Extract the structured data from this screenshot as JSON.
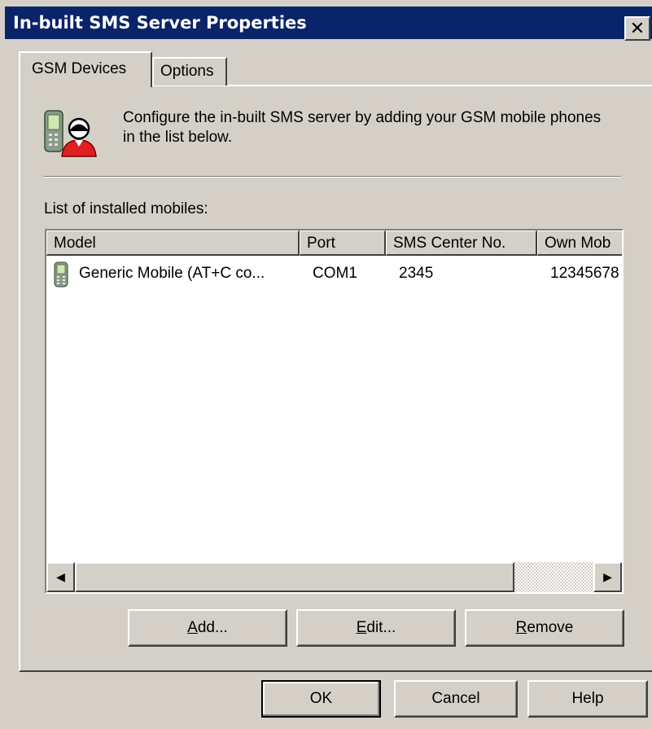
{
  "window": {
    "title": "In-built SMS Server Properties",
    "close_glyph": "✕"
  },
  "tabs": [
    {
      "label": "GSM Devices",
      "selected": true
    },
    {
      "label": "Options",
      "selected": false
    }
  ],
  "gsm_devices": {
    "header_icon": "mobile-user-icon",
    "intro_text": "Configure the in-built SMS server by adding your GSM mobile phones in the list below.",
    "list_label": "List of installed mobiles:",
    "columns": [
      "Model",
      "Port",
      "SMS Center No.",
      "Own Mob"
    ],
    "rows": [
      {
        "icon": "mobile-phone-icon",
        "model": "Generic Mobile (AT+C co...",
        "port": "COM1",
        "sms_center": "2345",
        "own_mobile": "12345678"
      }
    ],
    "buttons": {
      "add": {
        "accel": "A",
        "rest": "dd..."
      },
      "edit": {
        "accel": "E",
        "rest": "dit..."
      },
      "remove": {
        "accel": "R",
        "rest": "emove"
      }
    }
  },
  "footer": {
    "ok": "OK",
    "cancel": "Cancel",
    "help": "Help"
  },
  "scrollbar": {
    "left_glyph": "◀",
    "right_glyph": "▶"
  },
  "colors": {
    "titlebar": "#0a246a",
    "face": "#d4d0c8",
    "window_bg": "#ffffff"
  }
}
